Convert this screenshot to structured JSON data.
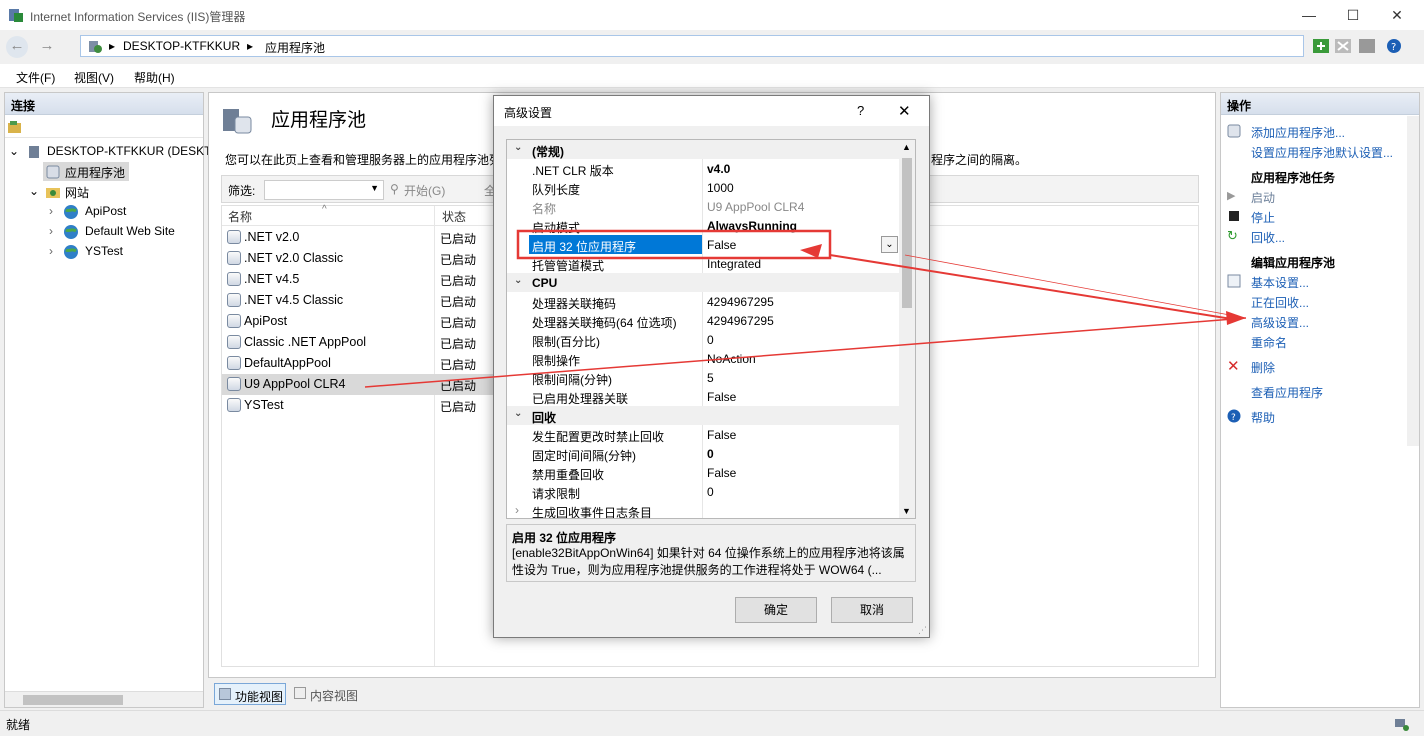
{
  "window": {
    "title": "Internet Information Services (IIS)管理器",
    "controls": {
      "minimize": "—",
      "maximize": "☐",
      "close": "✕"
    }
  },
  "address": {
    "segments": [
      "DESKTOP-KTFKKUR",
      "应用程序池"
    ],
    "separator": "▸"
  },
  "menu": {
    "items": [
      "文件(F)",
      "视图(V)",
      "帮助(H)"
    ]
  },
  "connections": {
    "header": "连接",
    "tree": [
      {
        "label": "DESKTOP-KTFKKUR (DESKT",
        "expander": "⌄"
      },
      {
        "label": "应用程序池",
        "selected": true
      },
      {
        "label": "网站",
        "expander": "⌄"
      },
      {
        "label": "ApiPost",
        "expander": "›"
      },
      {
        "label": "Default Web Site",
        "expander": "›"
      },
      {
        "label": "YSTest",
        "expander": "›"
      }
    ]
  },
  "main": {
    "title": "应用程序池",
    "description": "您可以在此页上查看和管理服务器上的应用程序池列",
    "description_tail": "程序之间的隔离。",
    "filter_label": "筛选:",
    "start_label": "开始(G)",
    "show_all_label": "全",
    "columns": [
      "名称",
      "状态"
    ],
    "pools": [
      {
        "name": ".NET v2.0",
        "status": "已启动"
      },
      {
        "name": ".NET v2.0 Classic",
        "status": "已启动"
      },
      {
        "name": ".NET v4.5",
        "status": "已启动"
      },
      {
        "name": ".NET v4.5 Classic",
        "status": "已启动"
      },
      {
        "name": "ApiPost",
        "status": "已启动"
      },
      {
        "name": "Classic .NET AppPool",
        "status": "已启动"
      },
      {
        "name": "DefaultAppPool",
        "status": "已启动"
      },
      {
        "name": "U9 AppPool CLR4",
        "status": "已启动",
        "selected": true
      },
      {
        "name": "YSTest",
        "status": "已启动"
      }
    ],
    "tabs": [
      "功能视图",
      "内容视图"
    ]
  },
  "actions": {
    "header": "操作",
    "items": [
      {
        "label": "添加应用程序池...",
        "type": "link",
        "icon": "add-pool-icon"
      },
      {
        "label": "设置应用程序池默认设置...",
        "type": "link"
      },
      {
        "label": "应用程序池任务",
        "type": "header"
      },
      {
        "label": "启动",
        "type": "disabled",
        "icon": "play-icon"
      },
      {
        "label": "停止",
        "type": "link",
        "icon": "stop-icon"
      },
      {
        "label": "回收...",
        "type": "link",
        "icon": "recycle-icon"
      },
      {
        "label": "编辑应用程序池",
        "type": "header"
      },
      {
        "label": "基本设置...",
        "type": "link",
        "icon": "basic-settings-icon"
      },
      {
        "label": "正在回收...",
        "type": "link"
      },
      {
        "label": "高级设置...",
        "type": "link"
      },
      {
        "label": "重命名",
        "type": "link"
      },
      {
        "label": "删除",
        "type": "link",
        "icon": "delete-icon"
      },
      {
        "label": "查看应用程序",
        "type": "link"
      },
      {
        "label": "帮助",
        "type": "link",
        "icon": "help-icon"
      }
    ]
  },
  "status": {
    "text": "就绪"
  },
  "dialog": {
    "title": "高级设置",
    "help": "?",
    "close": "✕",
    "rows": [
      {
        "type": "category",
        "label": "(常规)"
      },
      {
        "type": "prop",
        "key": ".NET CLR 版本",
        "value": "v4.0",
        "bold": true
      },
      {
        "type": "prop",
        "key": "队列长度",
        "value": "1000"
      },
      {
        "type": "prop",
        "key": "名称",
        "value": "U9 AppPool CLR4",
        "dim": true
      },
      {
        "type": "prop",
        "key": "启动模式",
        "value": "AlwaysRunning",
        "bold": true
      },
      {
        "type": "prop",
        "key": "启用 32 位应用程序",
        "value": "False",
        "selected": true
      },
      {
        "type": "prop",
        "key": "托管管道模式",
        "value": "Integrated"
      },
      {
        "type": "category",
        "label": "CPU"
      },
      {
        "type": "prop",
        "key": "处理器关联掩码",
        "value": "4294967295"
      },
      {
        "type": "prop",
        "key": "处理器关联掩码(64 位选项)",
        "value": "4294967295"
      },
      {
        "type": "prop",
        "key": "限制(百分比)",
        "value": "0"
      },
      {
        "type": "prop",
        "key": "限制操作",
        "value": "NoAction"
      },
      {
        "type": "prop",
        "key": "限制间隔(分钟)",
        "value": "5"
      },
      {
        "type": "prop",
        "key": "已启用处理器关联",
        "value": "False"
      },
      {
        "type": "category",
        "label": "回收"
      },
      {
        "type": "prop",
        "key": "发生配置更改时禁止回收",
        "value": "False"
      },
      {
        "type": "prop",
        "key": "固定时间间隔(分钟)",
        "value": "0",
        "bold": true
      },
      {
        "type": "prop",
        "key": "禁用重叠回收",
        "value": "False"
      },
      {
        "type": "prop",
        "key": "请求限制",
        "value": "0"
      },
      {
        "type": "subcategory",
        "key": "生成回收事件日志条目",
        "value": ""
      }
    ],
    "description_title": "启用 32 位应用程序",
    "description_text": "[enable32BitAppOnWin64] 如果针对 64 位操作系统上的应用程序池将该属性设为 True，则为应用程序池提供服务的工作进程将处于 WOW64 (...",
    "ok_label": "确定",
    "cancel_label": "取消"
  },
  "colors": {
    "accent": "#1c5fb5",
    "selection": "#0078d7",
    "annotation": "#e53935"
  }
}
